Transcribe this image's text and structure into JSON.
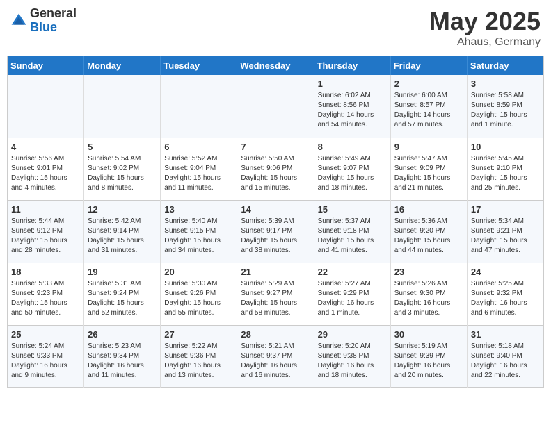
{
  "header": {
    "logo_general": "General",
    "logo_blue": "Blue",
    "title": "May 2025",
    "location": "Ahaus, Germany"
  },
  "weekdays": [
    "Sunday",
    "Monday",
    "Tuesday",
    "Wednesday",
    "Thursday",
    "Friday",
    "Saturday"
  ],
  "weeks": [
    [
      {
        "num": "",
        "detail": ""
      },
      {
        "num": "",
        "detail": ""
      },
      {
        "num": "",
        "detail": ""
      },
      {
        "num": "",
        "detail": ""
      },
      {
        "num": "1",
        "detail": "Sunrise: 6:02 AM\nSunset: 8:56 PM\nDaylight: 14 hours\nand 54 minutes."
      },
      {
        "num": "2",
        "detail": "Sunrise: 6:00 AM\nSunset: 8:57 PM\nDaylight: 14 hours\nand 57 minutes."
      },
      {
        "num": "3",
        "detail": "Sunrise: 5:58 AM\nSunset: 8:59 PM\nDaylight: 15 hours\nand 1 minute."
      }
    ],
    [
      {
        "num": "4",
        "detail": "Sunrise: 5:56 AM\nSunset: 9:01 PM\nDaylight: 15 hours\nand 4 minutes."
      },
      {
        "num": "5",
        "detail": "Sunrise: 5:54 AM\nSunset: 9:02 PM\nDaylight: 15 hours\nand 8 minutes."
      },
      {
        "num": "6",
        "detail": "Sunrise: 5:52 AM\nSunset: 9:04 PM\nDaylight: 15 hours\nand 11 minutes."
      },
      {
        "num": "7",
        "detail": "Sunrise: 5:50 AM\nSunset: 9:06 PM\nDaylight: 15 hours\nand 15 minutes."
      },
      {
        "num": "8",
        "detail": "Sunrise: 5:49 AM\nSunset: 9:07 PM\nDaylight: 15 hours\nand 18 minutes."
      },
      {
        "num": "9",
        "detail": "Sunrise: 5:47 AM\nSunset: 9:09 PM\nDaylight: 15 hours\nand 21 minutes."
      },
      {
        "num": "10",
        "detail": "Sunrise: 5:45 AM\nSunset: 9:10 PM\nDaylight: 15 hours\nand 25 minutes."
      }
    ],
    [
      {
        "num": "11",
        "detail": "Sunrise: 5:44 AM\nSunset: 9:12 PM\nDaylight: 15 hours\nand 28 minutes."
      },
      {
        "num": "12",
        "detail": "Sunrise: 5:42 AM\nSunset: 9:14 PM\nDaylight: 15 hours\nand 31 minutes."
      },
      {
        "num": "13",
        "detail": "Sunrise: 5:40 AM\nSunset: 9:15 PM\nDaylight: 15 hours\nand 34 minutes."
      },
      {
        "num": "14",
        "detail": "Sunrise: 5:39 AM\nSunset: 9:17 PM\nDaylight: 15 hours\nand 38 minutes."
      },
      {
        "num": "15",
        "detail": "Sunrise: 5:37 AM\nSunset: 9:18 PM\nDaylight: 15 hours\nand 41 minutes."
      },
      {
        "num": "16",
        "detail": "Sunrise: 5:36 AM\nSunset: 9:20 PM\nDaylight: 15 hours\nand 44 minutes."
      },
      {
        "num": "17",
        "detail": "Sunrise: 5:34 AM\nSunset: 9:21 PM\nDaylight: 15 hours\nand 47 minutes."
      }
    ],
    [
      {
        "num": "18",
        "detail": "Sunrise: 5:33 AM\nSunset: 9:23 PM\nDaylight: 15 hours\nand 50 minutes."
      },
      {
        "num": "19",
        "detail": "Sunrise: 5:31 AM\nSunset: 9:24 PM\nDaylight: 15 hours\nand 52 minutes."
      },
      {
        "num": "20",
        "detail": "Sunrise: 5:30 AM\nSunset: 9:26 PM\nDaylight: 15 hours\nand 55 minutes."
      },
      {
        "num": "21",
        "detail": "Sunrise: 5:29 AM\nSunset: 9:27 PM\nDaylight: 15 hours\nand 58 minutes."
      },
      {
        "num": "22",
        "detail": "Sunrise: 5:27 AM\nSunset: 9:29 PM\nDaylight: 16 hours\nand 1 minute."
      },
      {
        "num": "23",
        "detail": "Sunrise: 5:26 AM\nSunset: 9:30 PM\nDaylight: 16 hours\nand 3 minutes."
      },
      {
        "num": "24",
        "detail": "Sunrise: 5:25 AM\nSunset: 9:32 PM\nDaylight: 16 hours\nand 6 minutes."
      }
    ],
    [
      {
        "num": "25",
        "detail": "Sunrise: 5:24 AM\nSunset: 9:33 PM\nDaylight: 16 hours\nand 9 minutes."
      },
      {
        "num": "26",
        "detail": "Sunrise: 5:23 AM\nSunset: 9:34 PM\nDaylight: 16 hours\nand 11 minutes."
      },
      {
        "num": "27",
        "detail": "Sunrise: 5:22 AM\nSunset: 9:36 PM\nDaylight: 16 hours\nand 13 minutes."
      },
      {
        "num": "28",
        "detail": "Sunrise: 5:21 AM\nSunset: 9:37 PM\nDaylight: 16 hours\nand 16 minutes."
      },
      {
        "num": "29",
        "detail": "Sunrise: 5:20 AM\nSunset: 9:38 PM\nDaylight: 16 hours\nand 18 minutes."
      },
      {
        "num": "30",
        "detail": "Sunrise: 5:19 AM\nSunset: 9:39 PM\nDaylight: 16 hours\nand 20 minutes."
      },
      {
        "num": "31",
        "detail": "Sunrise: 5:18 AM\nSunset: 9:40 PM\nDaylight: 16 hours\nand 22 minutes."
      }
    ]
  ]
}
